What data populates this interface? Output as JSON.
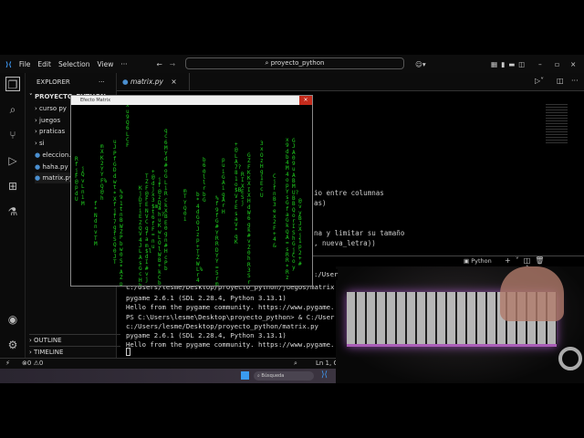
{
  "titlebar": {
    "menu": [
      "File",
      "Edit",
      "Selection",
      "View",
      "···"
    ],
    "search": "proyecto_python"
  },
  "sidebar": {
    "title": "EXPLORER",
    "more": "···",
    "project": "PROYECTO_PYTHON",
    "items": [
      {
        "label": "curso py",
        "type": "folder"
      },
      {
        "label": "juegos",
        "type": "folder"
      },
      {
        "label": "praticas",
        "type": "folder"
      },
      {
        "label": "si",
        "type": "folder"
      },
      {
        "label": "eleccion.py",
        "type": "file"
      },
      {
        "label": "haha.py",
        "type": "file"
      },
      {
        "label": "matrix.py",
        "type": "file"
      }
    ],
    "outline": "OUTLINE",
    "timeline": "TIMELINE"
  },
  "editor": {
    "tab": "matrix.py",
    "lines": [
      "io entre columnas",
      "as)",
      "",
      "",
      "na y limitar su tamaño",
      ", nueva_letra))"
    ]
  },
  "panel": {
    "shell": "Python",
    "partial": ":/User"
  },
  "terminal": [
    "c:/Users/lesme/Desktop/proyecto_python/juegos/matrix",
    "pygame 2.6.1 (SDL 2.28.4, Python 3.13.1)",
    "Hello from the pygame community. https://www.pygame.",
    "PS C:\\Users\\lesme\\Desktop\\proyecto_python> & C:/User",
    "c:/Users/lesme/Desktop/proyecto_python/matrix.py",
    "pygame 2.6.1 (SDL 2.28.4, Python 3.13.1)",
    "Hello from the pygame community. https://www.pygame."
  ],
  "status": {
    "errors": "0",
    "warnings": "0",
    "position": "Ln 1, C"
  },
  "taskbar": {
    "search": "Búsqueda"
  },
  "pygame": {
    "title": "Efecto Matrix",
    "glyphs": "ABCDEFGHIJKLMNOPQRSTUVWXYZabcdefghijklmnopqrstuvwxyz0123456789@#$%&*+=?"
  },
  "colors": {
    "matrix": "#1fd21f",
    "close": "#c42b1c"
  }
}
